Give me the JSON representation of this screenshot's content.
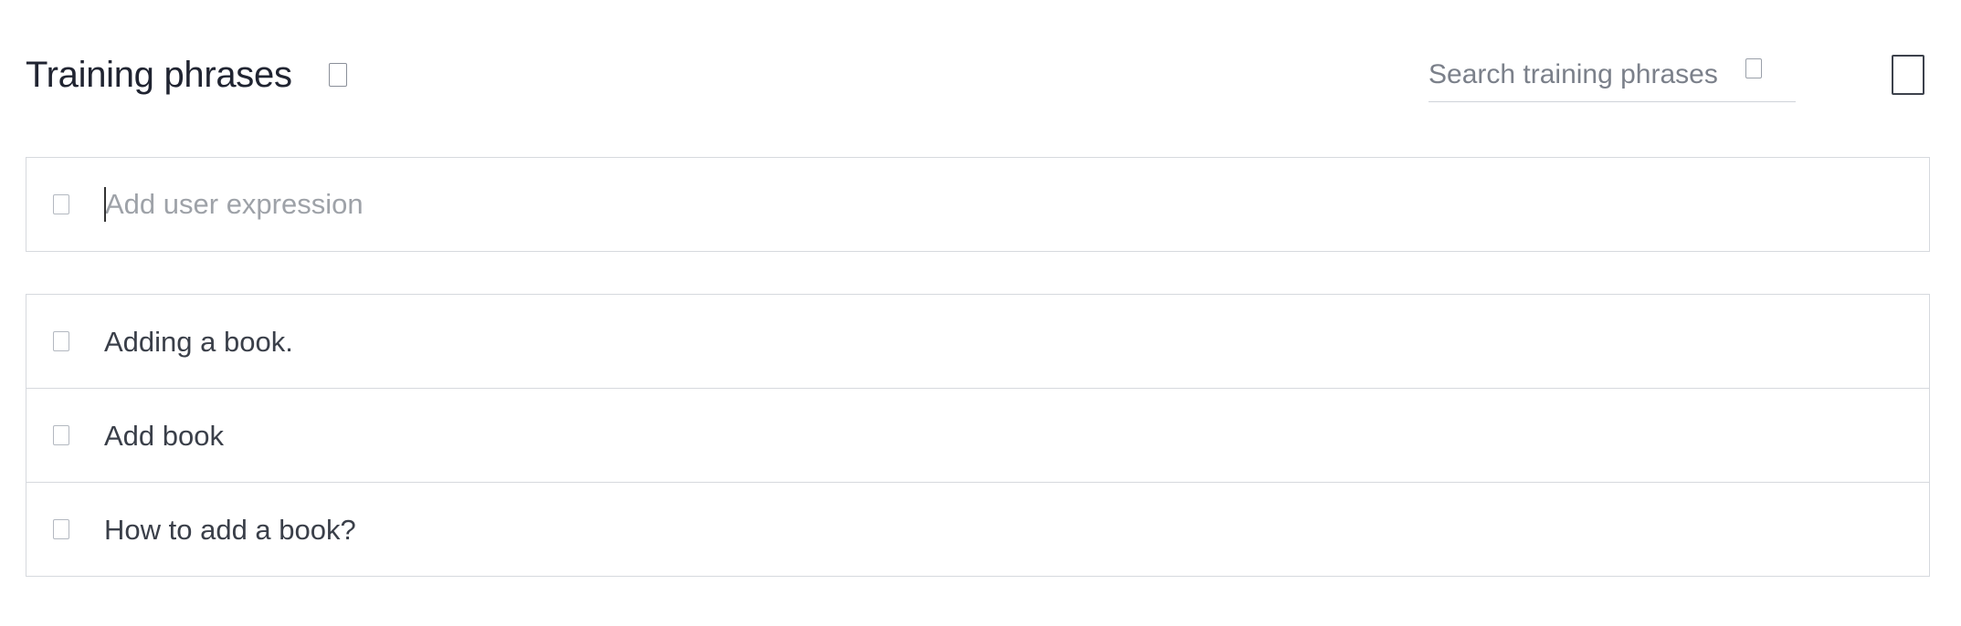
{
  "header": {
    "title": "Training phrases",
    "help_icon": "help-icon"
  },
  "search": {
    "placeholder": "Search training phrases",
    "value": "",
    "icon": "search-icon"
  },
  "menu": {
    "icon": "more-menu-icon"
  },
  "add_expression": {
    "placeholder": "Add user expression",
    "value": "",
    "icon": "quote-icon"
  },
  "phrases": [
    {
      "text": "Adding a book.",
      "icon": "quote-icon"
    },
    {
      "text": "Add book",
      "icon": "quote-icon"
    },
    {
      "text": "How to add a book?",
      "icon": "quote-icon"
    }
  ],
  "colors": {
    "text": "#202431",
    "border": "#d6d9de",
    "placeholder": "#9ea2a8"
  }
}
